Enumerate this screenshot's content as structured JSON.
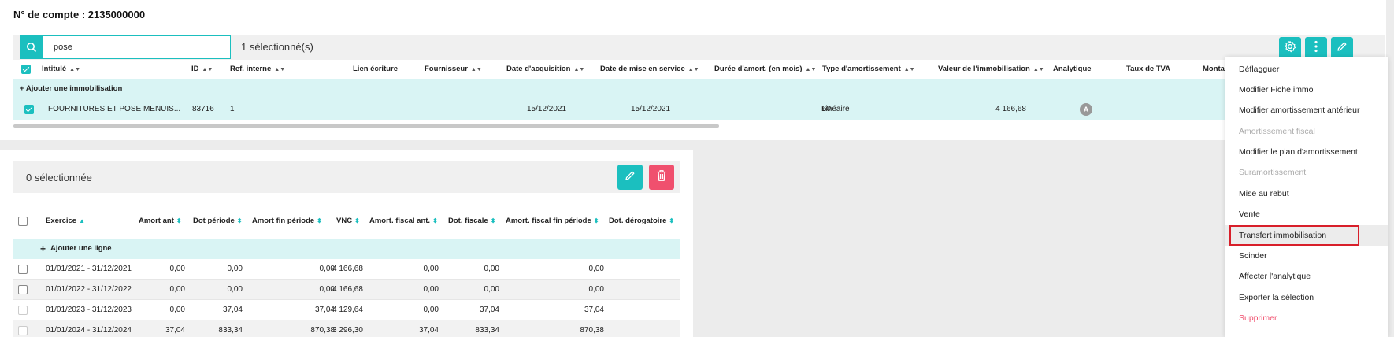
{
  "account": {
    "title": "N° de compte : 2135000000"
  },
  "toolbar": {
    "search_value": "pose",
    "selected_count": "1 sélectionné(s)",
    "icons": [
      "search-icon",
      "gear-icon",
      "more-vertical-icon",
      "pencil-icon"
    ],
    "accent_color": "#1bbfbf"
  },
  "grid": {
    "columns": [
      "Intitulé",
      "ID",
      "Ref. interne",
      "Lien écriture",
      "Fournisseur",
      "Date d'acquisition",
      "Date de mise en service",
      "Durée d'amort. (en mois)",
      "Type d'amortissement",
      "Valeur de l'immobilisation",
      "Analytique",
      "Taux de TVA",
      "Monta"
    ],
    "add_label": "+ Ajouter une immobilisation",
    "rows": [
      {
        "intitule": "FOURNITURES ET POSE MENUIS...",
        "id": "83716",
        "ref": "1",
        "date_acq": "15/12/2021",
        "date_mes": "15/12/2021",
        "duree": "60",
        "type": "Linéaire",
        "valeur": "4 166,68",
        "analytique": "A"
      }
    ]
  },
  "lower": {
    "selected_count": "0 sélectionnée",
    "delete_color": "#f0506e",
    "columns": [
      "Exercice",
      "Amort ant",
      "Dot période",
      "Amort fin période",
      "VNC",
      "Amort. fiscal ant.",
      "Dot. fiscale",
      "Amort. fiscal fin période",
      "Dot. dérogatoire"
    ],
    "add_label": "Ajouter une ligne",
    "rows": [
      {
        "exercice": "01/01/2021 - 31/12/2021",
        "amort_ant": "0,00",
        "dot": "0,00",
        "amort_fin": "0,00",
        "vnc": "4 166,68",
        "fisc_ant": "0,00",
        "dot_fisc": "0,00",
        "fisc_fin": "0,00"
      },
      {
        "exercice": "01/01/2022 - 31/12/2022",
        "amort_ant": "0,00",
        "dot": "0,00",
        "amort_fin": "0,00",
        "vnc": "4 166,68",
        "fisc_ant": "0,00",
        "dot_fisc": "0,00",
        "fisc_fin": "0,00"
      },
      {
        "exercice": "01/01/2023 - 31/12/2023",
        "amort_ant": "0,00",
        "dot": "37,04",
        "amort_fin": "37,04",
        "vnc": "4 129,64",
        "fisc_ant": "0,00",
        "dot_fisc": "37,04",
        "fisc_fin": "37,04"
      },
      {
        "exercice": "01/01/2024 - 31/12/2024",
        "amort_ant": "37,04",
        "dot": "833,34",
        "amort_fin": "870,38",
        "vnc": "3 296,30",
        "fisc_ant": "37,04",
        "dot_fisc": "833,34",
        "fisc_fin": "870,38"
      }
    ]
  },
  "menu": {
    "items": [
      {
        "label": "Déflagguer",
        "state": "normal"
      },
      {
        "label": "Modifier Fiche immo",
        "state": "normal"
      },
      {
        "label": "Modifier amortissement antérieur",
        "state": "normal"
      },
      {
        "label": "Amortissement fiscal",
        "state": "disabled"
      },
      {
        "label": "Modifier le plan d'amortissement",
        "state": "normal"
      },
      {
        "label": "Suramortissement",
        "state": "disabled"
      },
      {
        "label": "Mise au rebut",
        "state": "normal"
      },
      {
        "label": "Vente",
        "state": "normal"
      },
      {
        "label": "Transfert immobilisation",
        "state": "highlighted"
      },
      {
        "label": "Scinder",
        "state": "normal"
      },
      {
        "label": "Affecter l'analytique",
        "state": "normal"
      },
      {
        "label": "Exporter la sélection",
        "state": "normal"
      },
      {
        "label": "Supprimer",
        "state": "danger"
      }
    ]
  }
}
